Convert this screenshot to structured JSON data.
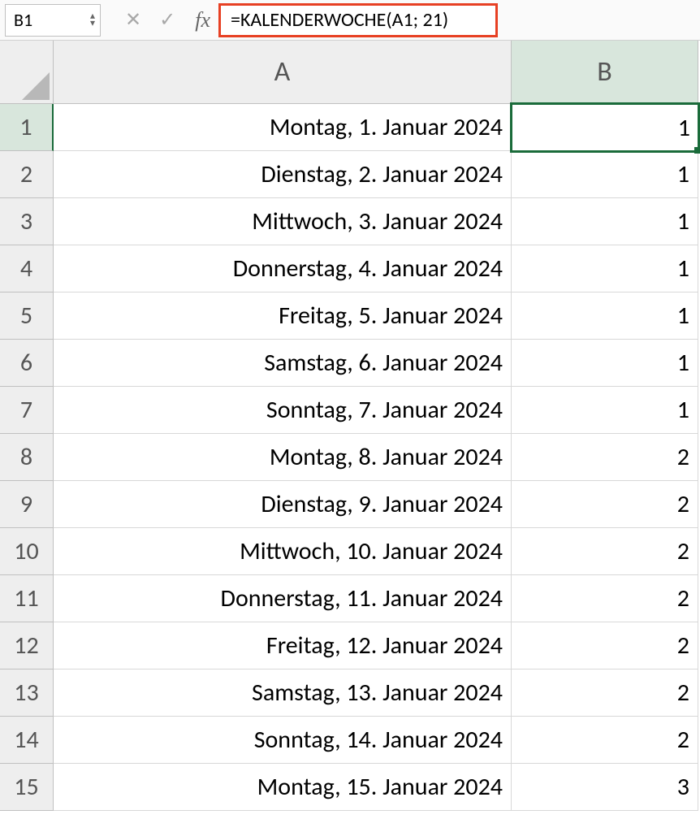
{
  "formulaBar": {
    "nameBox": "B1",
    "formula": "=KALENDERWOCHE(A1; 21)",
    "fxLabel": "fx"
  },
  "columns": [
    "A",
    "B"
  ],
  "selectedCell": "B1",
  "rows": [
    {
      "n": "1",
      "a": "Montag, 1. Januar 2024",
      "b": "1"
    },
    {
      "n": "2",
      "a": "Dienstag, 2. Januar 2024",
      "b": "1"
    },
    {
      "n": "3",
      "a": "Mittwoch, 3. Januar 2024",
      "b": "1"
    },
    {
      "n": "4",
      "a": "Donnerstag, 4. Januar 2024",
      "b": "1"
    },
    {
      "n": "5",
      "a": "Freitag, 5. Januar 2024",
      "b": "1"
    },
    {
      "n": "6",
      "a": "Samstag, 6. Januar 2024",
      "b": "1"
    },
    {
      "n": "7",
      "a": "Sonntag, 7. Januar 2024",
      "b": "1"
    },
    {
      "n": "8",
      "a": "Montag, 8. Januar 2024",
      "b": "2"
    },
    {
      "n": "9",
      "a": "Dienstag, 9. Januar 2024",
      "b": "2"
    },
    {
      "n": "10",
      "a": "Mittwoch, 10. Januar 2024",
      "b": "2"
    },
    {
      "n": "11",
      "a": "Donnerstag, 11. Januar 2024",
      "b": "2"
    },
    {
      "n": "12",
      "a": "Freitag, 12. Januar 2024",
      "b": "2"
    },
    {
      "n": "13",
      "a": "Samstag, 13. Januar 2024",
      "b": "2"
    },
    {
      "n": "14",
      "a": "Sonntag, 14. Januar 2024",
      "b": "2"
    },
    {
      "n": "15",
      "a": "Montag, 15. Januar 2024",
      "b": "3"
    }
  ]
}
